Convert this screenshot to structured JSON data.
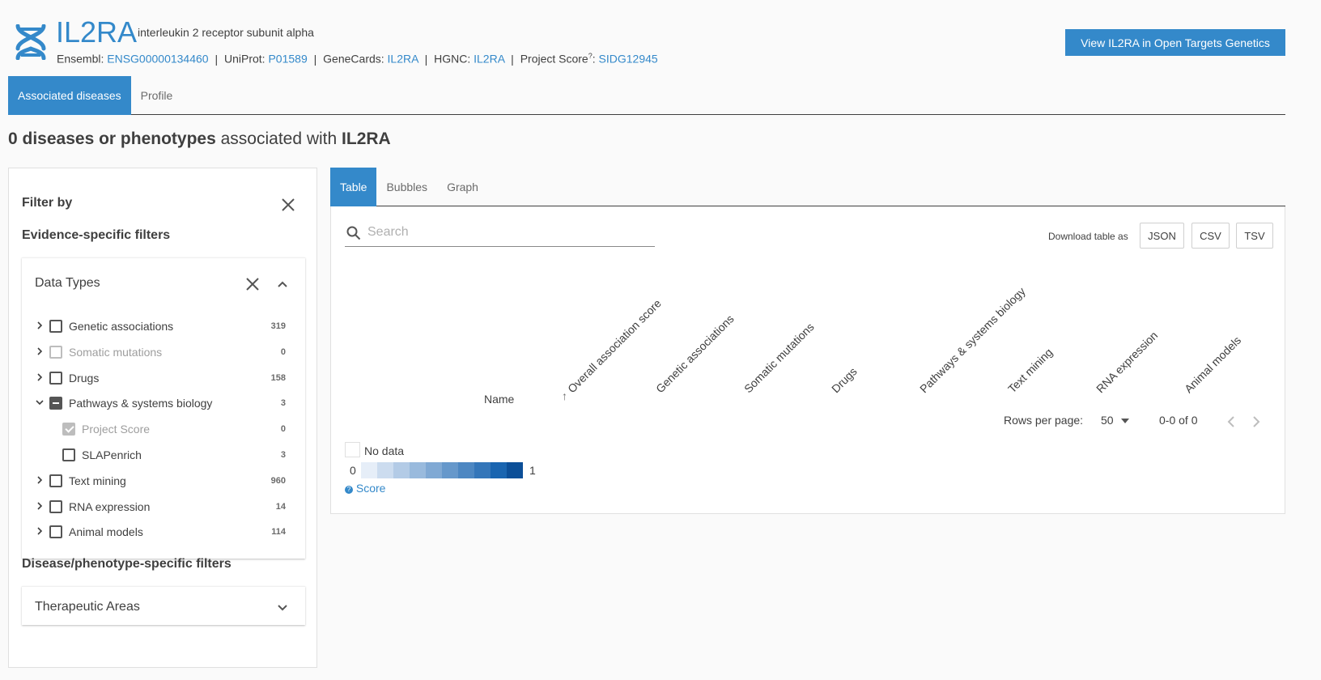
{
  "header": {
    "symbol": "IL2RA",
    "name": "interleukin 2 receptor subunit alpha",
    "xrefs": {
      "ensembl_label": "Ensembl:",
      "ensembl_id": "ENSG00000134460",
      "uniprot_label": "UniProt:",
      "uniprot_id": "P01589",
      "genecards_label": "GeneCards:",
      "genecards_id": "IL2RA",
      "hgnc_label": "HGNC:",
      "hgnc_id": "IL2RA",
      "project_score_label": "Project Score",
      "project_score_help": "?",
      "project_score_id": "SIDG12945",
      "separator": "|"
    },
    "otg_button": "View IL2RA in Open Targets Genetics"
  },
  "page_tabs": [
    {
      "label": "Associated diseases",
      "active": true
    },
    {
      "label": "Profile",
      "active": false
    }
  ],
  "summary": {
    "count_text": "0 diseases or phenotypes",
    "middle": " associated with ",
    "target": "IL2RA"
  },
  "filters": {
    "title": "Filter by",
    "evidence_title": "Evidence-specific filters",
    "data_types_title": "Data Types",
    "data_types": [
      {
        "label": "Genetic associations",
        "count": "319",
        "state": "unchecked",
        "expand": "collapsed",
        "disabled": false,
        "indent": 0
      },
      {
        "label": "Somatic mutations",
        "count": "0",
        "state": "unchecked",
        "expand": "collapsed",
        "disabled": true,
        "indent": 0
      },
      {
        "label": "Drugs",
        "count": "158",
        "state": "unchecked",
        "expand": "collapsed",
        "disabled": false,
        "indent": 0
      },
      {
        "label": "Pathways & systems biology",
        "count": "3",
        "state": "indeterminate",
        "expand": "expanded",
        "disabled": false,
        "indent": 0
      },
      {
        "label": "Project Score",
        "count": "0",
        "state": "checked-disabled",
        "expand": "none",
        "disabled": true,
        "indent": 1
      },
      {
        "label": "SLAPenrich",
        "count": "3",
        "state": "unchecked",
        "expand": "none",
        "disabled": false,
        "indent": 1
      },
      {
        "label": "Text mining",
        "count": "960",
        "state": "unchecked",
        "expand": "collapsed",
        "disabled": false,
        "indent": 0
      },
      {
        "label": "RNA expression",
        "count": "14",
        "state": "unchecked",
        "expand": "collapsed",
        "disabled": false,
        "indent": 0
      },
      {
        "label": "Animal models",
        "count": "114",
        "state": "unchecked",
        "expand": "collapsed",
        "disabled": false,
        "indent": 0
      }
    ],
    "disease_title": "Disease/phenotype-specific filters",
    "therapeutic_title": "Therapeutic Areas"
  },
  "view_tabs": [
    {
      "label": "Table",
      "active": true
    },
    {
      "label": "Bubbles",
      "active": false
    },
    {
      "label": "Graph",
      "active": false
    }
  ],
  "table": {
    "search_placeholder": "Search",
    "download_label": "Download table as",
    "download_buttons": [
      "JSON",
      "CSV",
      "TSV"
    ],
    "name_column": "Name",
    "columns": [
      "Overall association score",
      "Genetic associations",
      "Somatic mutations",
      "Drugs",
      "Pathways & systems biology",
      "Text mining",
      "RNA expression",
      "Animal models"
    ],
    "sort_arrow": "↑",
    "rows_per_page_label": "Rows per page:",
    "rows_per_page": "50",
    "range": "0-0 of 0"
  },
  "legend": {
    "no_data": "No data",
    "min": "0",
    "max": "1",
    "score_link": "Score",
    "scale_colors": [
      "#e6eef8",
      "#ccdcef",
      "#b3cbe6",
      "#99badd",
      "#80a9d4",
      "#6698cb",
      "#4d87c2",
      "#3476b9",
      "#1a65b0",
      "#0c4f98"
    ]
  },
  "colors": {
    "accent": "#3489ca",
    "text": "#3f3f3f"
  }
}
